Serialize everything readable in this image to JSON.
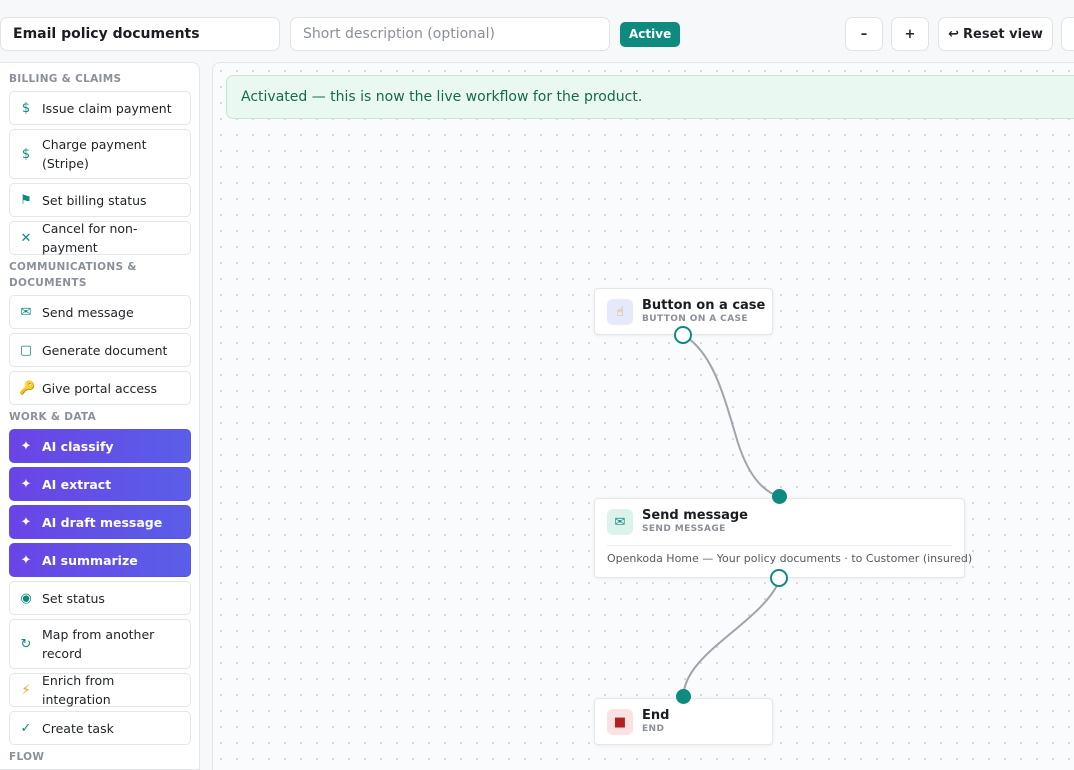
{
  "header": {
    "workflow_name": "Email policy documents",
    "description_placeholder": "Short description (optional)",
    "status_badge": "Active",
    "zoom_out_label": "–",
    "zoom_in_label": "+",
    "reset_icon": "↩",
    "reset_label": "Reset view"
  },
  "sidebar": {
    "sections": [
      {
        "title": "BILLING & CLAIMS"
      },
      {
        "title": "COMMUNICATIONS & DOCUMENTS"
      },
      {
        "title": "WORK & DATA"
      },
      {
        "title": "FLOW"
      }
    ],
    "items": [
      {
        "label": "Issue claim payment",
        "icon": "dollar-icon",
        "glyph": "$"
      },
      {
        "label": "Charge payment (Stripe)",
        "icon": "dollar-icon",
        "glyph": "$"
      },
      {
        "label": "Set billing status",
        "icon": "flag-icon",
        "glyph": "⚑"
      },
      {
        "label": "Cancel for non-payment",
        "icon": "x-icon",
        "glyph": "✕"
      },
      {
        "label": "Send message",
        "icon": "mail-icon",
        "glyph": "✉"
      },
      {
        "label": "Generate document",
        "icon": "document-icon",
        "glyph": "▢"
      },
      {
        "label": "Give portal access",
        "icon": "key-icon",
        "glyph": "🔑"
      },
      {
        "label": "AI classify",
        "icon": "sparkle-icon",
        "glyph": "✦"
      },
      {
        "label": "AI extract",
        "icon": "sparkle-icon",
        "glyph": "✦"
      },
      {
        "label": "AI draft message",
        "icon": "sparkle-icon",
        "glyph": "✦"
      },
      {
        "label": "AI summarize",
        "icon": "sparkle-icon",
        "glyph": "✦"
      },
      {
        "label": "Set status",
        "icon": "status-dot-icon",
        "glyph": "◉"
      },
      {
        "label": "Map from another record",
        "icon": "refresh-icon",
        "glyph": "↻"
      },
      {
        "label": "Enrich from integration",
        "icon": "lightning-icon",
        "glyph": "⚡"
      },
      {
        "label": "Create task",
        "icon": "check-icon",
        "glyph": "✓"
      }
    ]
  },
  "canvas": {
    "banner": "Activated — this is now the live workflow for the product.",
    "nodes": [
      {
        "title": "Button on a case",
        "subtitle": "BUTTON ON A CASE",
        "icon": "pointer-hand-icon",
        "glyph": "☝"
      },
      {
        "title": "Send message",
        "subtitle": "SEND MESSAGE",
        "icon": "mail-icon",
        "glyph": "✉",
        "detail": "Openkoda Home — Your policy documents · to Customer (insured)"
      },
      {
        "title": "End",
        "subtitle": "END",
        "icon": "stop-icon",
        "glyph": "■"
      }
    ]
  },
  "colors": {
    "accent": "#0f8a7e",
    "ai_gradient_start": "#6a44e6",
    "ai_gradient_end": "#5a5ee8",
    "banner_bg": "#e9f9f1"
  }
}
